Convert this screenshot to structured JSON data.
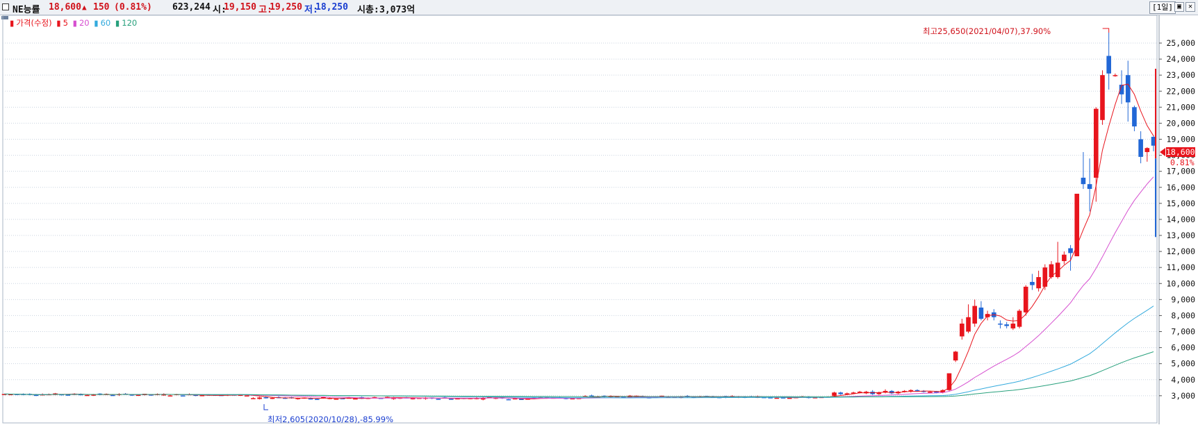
{
  "header": {
    "stock_name": "NE능률",
    "price": "18,600",
    "change_arrow": "▲",
    "change": "150",
    "change_pct": "(0.81%)",
    "volume": "623,244",
    "open_label": "시:",
    "open": "19,150",
    "high_label": "고:",
    "high": "19,250",
    "low_label": "저:",
    "low": "18,250",
    "mcap_label": "시총:",
    "mcap": "3,073억",
    "period_button": "[1일]",
    "restore_button": "▣",
    "close_button": "✕"
  },
  "legend": {
    "price": "가격(수정)",
    "ma5": "5",
    "ma20": "20",
    "ma60": "60",
    "ma120": "120"
  },
  "annotations": {
    "high": "최고25,650(2021/04/07),37.90%",
    "low": "최저2,605(2020/10/28),-85.99%"
  },
  "price_label": {
    "current": "18,600",
    "change_pct": "0.81%"
  },
  "colors": {
    "up": "#e8151d",
    "down": "#2167d6",
    "ma5": "#e8151d",
    "ma20": "#d64fd0",
    "ma60": "#33aadd",
    "ma120": "#27a07c",
    "grid": "#c9d3df"
  },
  "chart_data": {
    "type": "candlestick",
    "ylim": [
      2300,
      26300
    ],
    "y_ticks": [
      3000,
      4000,
      5000,
      6000,
      7000,
      8000,
      9000,
      10000,
      11000,
      12000,
      13000,
      14000,
      15000,
      16000,
      17000,
      18000,
      19000,
      20000,
      21000,
      22000,
      23000,
      24000,
      25000
    ],
    "y_tick_labels": [
      "3,000",
      "4,000",
      "5,000",
      "6,000",
      "7,000",
      "8,000",
      "9,000",
      "10,000",
      "11,000",
      "12,000",
      "13,000",
      "14,000",
      "15,000",
      "16,000",
      "17,000",
      "18,000",
      "19,000",
      "20,000",
      "21,000",
      "22,000",
      "23,000",
      "24,000",
      "25,000"
    ],
    "flat_segment": {
      "bars": 130,
      "price_start": 3100,
      "price_end": 2900,
      "price_mid": 2850
    },
    "candles": [
      {
        "o": 3000,
        "h": 3250,
        "l": 2950,
        "c": 3200
      },
      {
        "o": 3200,
        "h": 3250,
        "l": 3050,
        "c": 3100
      },
      {
        "o": 3100,
        "h": 3200,
        "l": 3050,
        "c": 3150
      },
      {
        "o": 3150,
        "h": 3250,
        "l": 3100,
        "c": 3200
      },
      {
        "o": 3200,
        "h": 3300,
        "l": 3150,
        "c": 3250
      },
      {
        "o": 3150,
        "h": 3300,
        "l": 3100,
        "c": 3250
      },
      {
        "o": 3250,
        "h": 3350,
        "l": 3050,
        "c": 3100
      },
      {
        "o": 3100,
        "h": 3250,
        "l": 3050,
        "c": 3200
      },
      {
        "o": 3200,
        "h": 3400,
        "l": 3150,
        "c": 3300
      },
      {
        "o": 3300,
        "h": 3350,
        "l": 3100,
        "c": 3150
      },
      {
        "o": 3150,
        "h": 3300,
        "l": 3100,
        "c": 3250
      },
      {
        "o": 3250,
        "h": 3350,
        "l": 3200,
        "c": 3300
      },
      {
        "o": 3300,
        "h": 3400,
        "l": 3200,
        "c": 3350
      },
      {
        "o": 3350,
        "h": 3400,
        "l": 3250,
        "c": 3300
      },
      {
        "o": 3300,
        "h": 3350,
        "l": 3200,
        "c": 3250
      },
      {
        "o": 3200,
        "h": 3300,
        "l": 3150,
        "c": 3250
      },
      {
        "o": 3250,
        "h": 3300,
        "l": 3150,
        "c": 3200
      },
      {
        "o": 3200,
        "h": 3400,
        "l": 3150,
        "c": 3350
      },
      {
        "o": 3350,
        "h": 4400,
        "l": 3300,
        "c": 4400
      },
      {
        "o": 5200,
        "h": 5800,
        "l": 5100,
        "c": 5750
      },
      {
        "o": 6700,
        "h": 7800,
        "l": 6500,
        "c": 7500
      },
      {
        "o": 7000,
        "h": 8700,
        "l": 6900,
        "c": 7900
      },
      {
        "o": 7500,
        "h": 9000,
        "l": 7300,
        "c": 8600
      },
      {
        "o": 8500,
        "h": 8900,
        "l": 7700,
        "c": 7800
      },
      {
        "o": 7900,
        "h": 8300,
        "l": 7700,
        "c": 8100
      },
      {
        "o": 8200,
        "h": 8400,
        "l": 7700,
        "c": 7900
      },
      {
        "o": 7500,
        "h": 7700,
        "l": 7200,
        "c": 7450
      },
      {
        "o": 7450,
        "h": 7600,
        "l": 7200,
        "c": 7350
      },
      {
        "o": 7200,
        "h": 7900,
        "l": 7100,
        "c": 7500
      },
      {
        "o": 7300,
        "h": 8400,
        "l": 7200,
        "c": 8300
      },
      {
        "o": 8200,
        "h": 9900,
        "l": 8000,
        "c": 9800
      },
      {
        "o": 10100,
        "h": 10600,
        "l": 9600,
        "c": 9900
      },
      {
        "o": 9700,
        "h": 10800,
        "l": 9500,
        "c": 10400
      },
      {
        "o": 9800,
        "h": 11200,
        "l": 9600,
        "c": 11000
      },
      {
        "o": 10400,
        "h": 11400,
        "l": 10300,
        "c": 11200
      },
      {
        "o": 10400,
        "h": 12600,
        "l": 10300,
        "c": 11300
      },
      {
        "o": 11400,
        "h": 12000,
        "l": 11200,
        "c": 11800
      },
      {
        "o": 12200,
        "h": 12400,
        "l": 10800,
        "c": 11900
      },
      {
        "o": 11700,
        "h": 15600,
        "l": 11700,
        "c": 15600
      },
      {
        "o": 16600,
        "h": 18200,
        "l": 15900,
        "c": 16200
      },
      {
        "o": 16200,
        "h": 17800,
        "l": 14500,
        "c": 15900
      },
      {
        "o": 16600,
        "h": 21000,
        "l": 15100,
        "c": 20900
      },
      {
        "o": 20200,
        "h": 23300,
        "l": 19900,
        "c": 23000
      },
      {
        "o": 24200,
        "h": 25650,
        "l": 22100,
        "c": 23100
      },
      {
        "o": 23000,
        "h": 23100,
        "l": 22900,
        "c": 23000
      },
      {
        "o": 22400,
        "h": 23300,
        "l": 21200,
        "c": 21800
      },
      {
        "o": 23000,
        "h": 23900,
        "l": 20100,
        "c": 21300
      },
      {
        "o": 21000,
        "h": 21100,
        "l": 19500,
        "c": 19800
      },
      {
        "o": 19000,
        "h": 19500,
        "l": 17500,
        "c": 17900
      },
      {
        "o": 18200,
        "h": 18500,
        "l": 17600,
        "c": 18450
      },
      {
        "o": 19150,
        "h": 19250,
        "l": 18250,
        "c": 18600
      }
    ]
  }
}
